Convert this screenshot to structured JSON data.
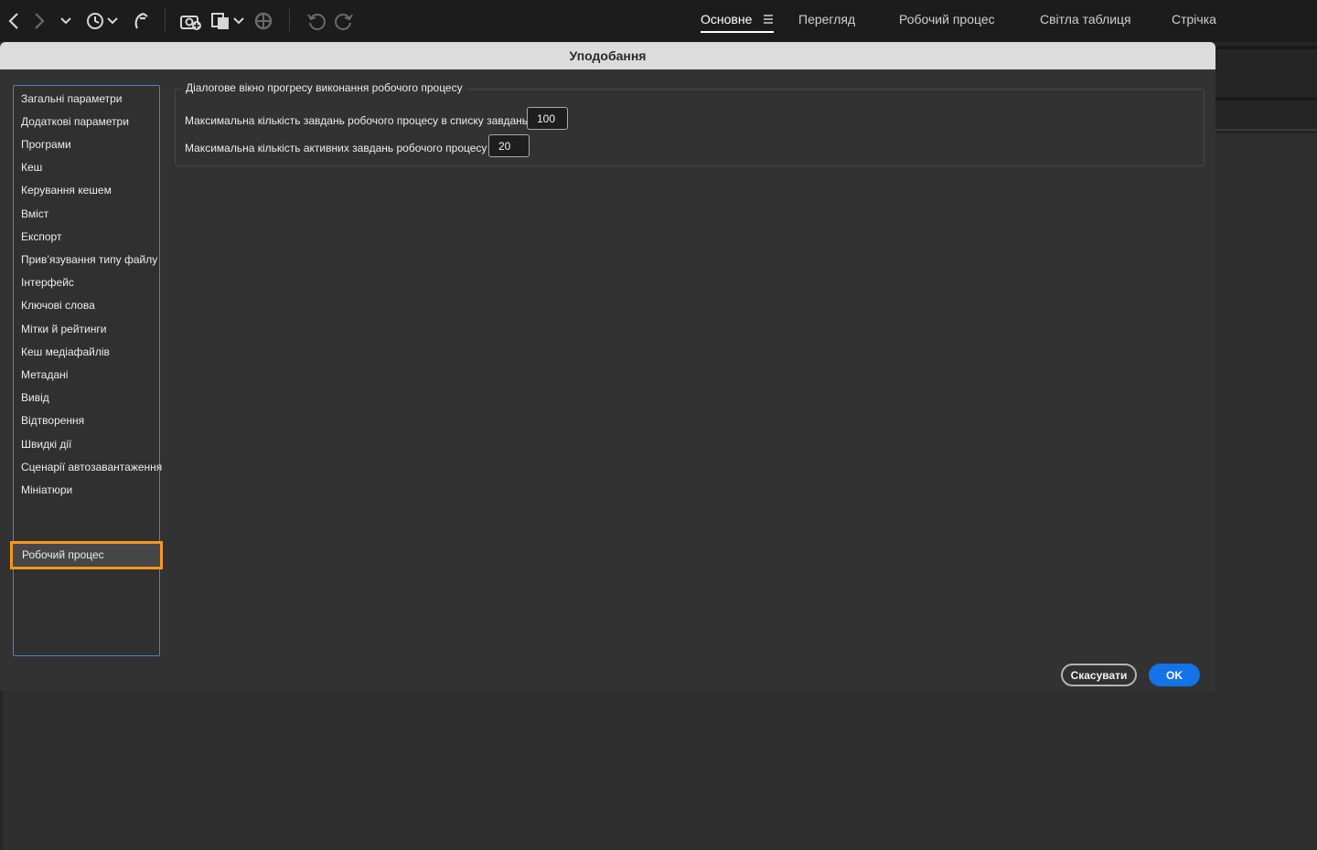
{
  "toolbar": {
    "icons": [
      "back-icon",
      "forward-icon",
      "chevron-down-icon",
      "history-icon",
      "boomerang-icon",
      "camera-import-icon",
      "copy-stack-icon",
      "refine-icon",
      "rotate-left-icon",
      "rotate-right-icon"
    ]
  },
  "workspaces": {
    "tabs": [
      {
        "label": "Основне",
        "active": true
      },
      {
        "label": "Перегляд"
      },
      {
        "label": "Робочий процес"
      },
      {
        "label": "Світла таблиця"
      },
      {
        "label": "Стрічка"
      }
    ]
  },
  "dialog": {
    "title": "Уподобання",
    "sidebar": {
      "items": [
        {
          "label": "Загальні параметри"
        },
        {
          "label": "Додаткові параметри"
        },
        {
          "label": "Програми"
        },
        {
          "label": "Кеш"
        },
        {
          "label": "Керування кешем"
        },
        {
          "label": "Вміст"
        },
        {
          "label": "Експорт"
        },
        {
          "label": "Прив’язування типу файлу"
        },
        {
          "label": "Інтерфейс"
        },
        {
          "label": "Ключові слова"
        },
        {
          "label": "Мітки й рейтинги"
        },
        {
          "label": "Кеш медіафайлів"
        },
        {
          "label": "Метадані"
        },
        {
          "label": "Вивід"
        },
        {
          "label": "Відтворення"
        },
        {
          "label": "Швидкі дії"
        },
        {
          "label": "Сценарії автозавантаження"
        },
        {
          "label": "Мініатюри"
        },
        {
          "label": "Робочий процес",
          "selected": true
        }
      ]
    },
    "group": {
      "title": "Діалогове вікно прогресу виконання робочого процесу",
      "fields": [
        {
          "label": "Максимальна кількість завдань робочого процесу в списку завдань",
          "value": "100"
        },
        {
          "label": "Максимальна кількість активних завдань робочого процесу",
          "value": "20"
        }
      ]
    },
    "buttons": {
      "cancel": "Скасувати",
      "ok": "OK"
    },
    "accent_color": "#1473e6",
    "highlight_color": "#f7961e"
  }
}
